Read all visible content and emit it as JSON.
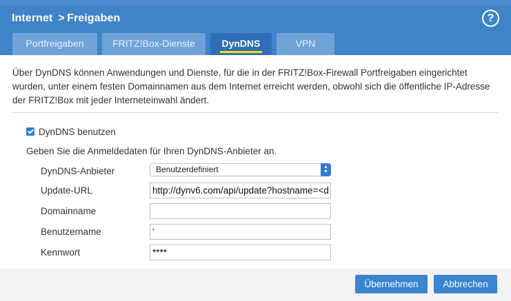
{
  "header": {
    "title": "Internet  > Freigaben",
    "help_glyph": "?"
  },
  "tabs": [
    {
      "label": "Portfreigaben",
      "active": false
    },
    {
      "label": "FRITZ!Box-Dienste",
      "active": false
    },
    {
      "label": "DynDNS",
      "active": true
    },
    {
      "label": "VPN",
      "active": false
    }
  ],
  "intro_text": "Über DynDNS können Anwendungen und Dienste, für die in der FRITZ!Box-Firewall Portfreigaben eingerichtet wurden, unter einem festen Domainnamen aus dem Internet erreicht werden, obwohl sich die öffentliche IP-Adresse der FRITZ!Box mit jeder Interneteinwahl ändert.",
  "use_dyndns": {
    "label": "DynDNS benutzen",
    "checked": true
  },
  "hint": "Geben Sie die Anmeldedaten für Ihren DynDNS-Anbieter an.",
  "form": {
    "provider": {
      "label": "DynDNS-Anbieter",
      "value": "Benutzerdefiniert"
    },
    "update_url": {
      "label": "Update-URL",
      "value": "http://dynv6.com/api/update?hostname=<d"
    },
    "domain": {
      "label": "Domainname",
      "value": ""
    },
    "username": {
      "label": "Benutzername",
      "value": "'"
    },
    "password": {
      "label": "Kennwort",
      "value": "****"
    }
  },
  "buttons": {
    "apply": "Übernehmen",
    "cancel": "Abbrechen"
  },
  "colors": {
    "header": "#3f83c9",
    "tab_active": "#2c6fb8",
    "tab_inactive": "#6fa3d8",
    "tab_underline": "#ffe100",
    "button": "#3a84d0"
  }
}
